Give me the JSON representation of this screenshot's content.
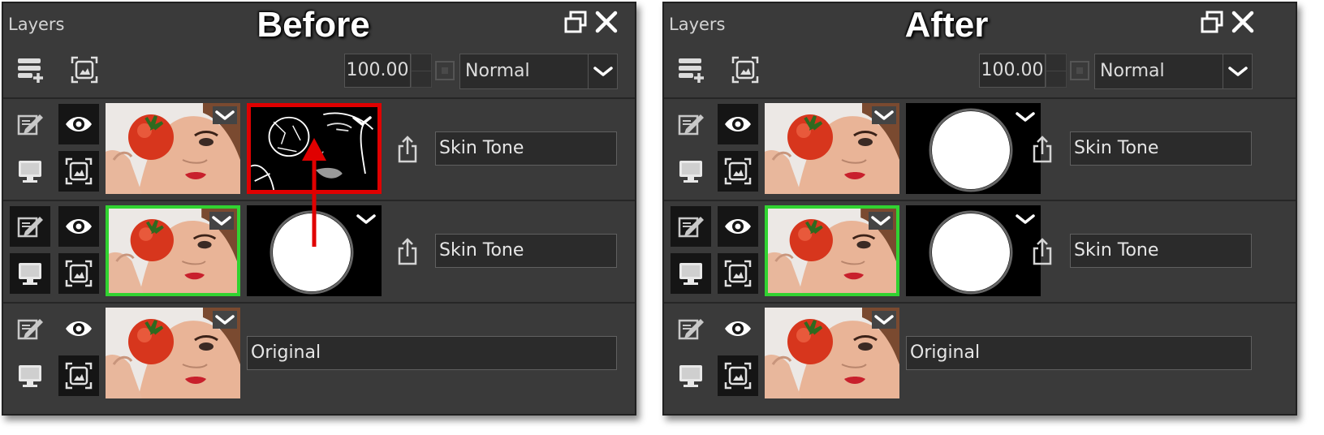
{
  "before_panel": {
    "panel_title": "Layers",
    "heading": "Before",
    "toolbar": {
      "opacity": "100.00",
      "blend_mode": "Normal"
    },
    "layers": [
      {
        "name": "Skin Tone",
        "selected": false,
        "mask": "edge-detected face (bad mask)",
        "mask_highlight": "red"
      },
      {
        "name": "Skin Tone",
        "selected": true,
        "mask": "white circle"
      },
      {
        "name": "Original",
        "selected": false
      }
    ],
    "annotation": {
      "arrow_color": "#e00000"
    }
  },
  "after_panel": {
    "panel_title": "Layers",
    "heading": "After",
    "toolbar": {
      "opacity": "100.00",
      "blend_mode": "Normal"
    },
    "layers": [
      {
        "name": "Skin Tone",
        "selected": false,
        "mask": "white circle"
      },
      {
        "name": "Skin Tone",
        "selected": true,
        "mask": "white circle"
      },
      {
        "name": "Original",
        "selected": false
      }
    ]
  },
  "colors": {
    "selected_border": "#31d331",
    "highlight_border": "#e00000",
    "panel_bg": "#3a3a3a"
  }
}
